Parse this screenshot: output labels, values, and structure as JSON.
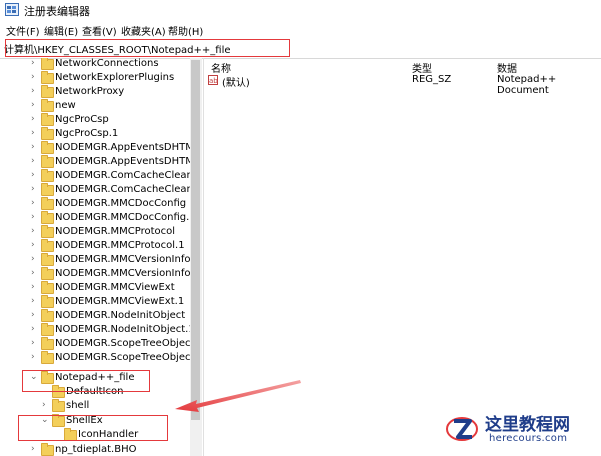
{
  "window": {
    "title": "注册表编辑器"
  },
  "menu": [
    {
      "label": "文件(F)"
    },
    {
      "label": "编辑(E)"
    },
    {
      "label": "查看(V)"
    },
    {
      "label": "收藏夹(A)"
    },
    {
      "label": "帮助(H)"
    }
  ],
  "address": "计算机\\HKEY_CLASSES_ROOT\\Notepad++_file",
  "tree": [
    {
      "label": "NetworkConnections"
    },
    {
      "label": "NetworkExplorerPlugins"
    },
    {
      "label": "NetworkProxy"
    },
    {
      "label": "new"
    },
    {
      "label": "NgcProCsp"
    },
    {
      "label": "NgcProCsp.1"
    },
    {
      "label": "NODEMGR.AppEventsDHTMLCo"
    },
    {
      "label": "NODEMGR.AppEventsDHTMLCo"
    },
    {
      "label": "NODEMGR.ComCacheCleanup"
    },
    {
      "label": "NODEMGR.ComCacheCleanup.1"
    },
    {
      "label": "NODEMGR.MMCDocConfig"
    },
    {
      "label": "NODEMGR.MMCDocConfig.1"
    },
    {
      "label": "NODEMGR.MMCProtocol"
    },
    {
      "label": "NODEMGR.MMCProtocol.1"
    },
    {
      "label": "NODEMGR.MMCVersionInfo"
    },
    {
      "label": "NODEMGR.MMCVersionInfo.1"
    },
    {
      "label": "NODEMGR.MMCViewExt"
    },
    {
      "label": "NODEMGR.MMCViewExt.1"
    },
    {
      "label": "NODEMGR.NodeInitObject"
    },
    {
      "label": "NODEMGR.NodeInitObject.1"
    },
    {
      "label": "NODEMGR.ScopeTreeObject"
    },
    {
      "label": "NODEMGR.ScopeTreeObject.1"
    },
    {
      "label": "Notepad++_file"
    },
    {
      "label": "DefaultIcon"
    },
    {
      "label": "shell"
    },
    {
      "label": "ShellEx"
    },
    {
      "label": "IconHandler"
    },
    {
      "label": "np_tdieplat.BHO"
    }
  ],
  "list": {
    "headers": {
      "name": "名称",
      "type": "类型",
      "data": "数据"
    },
    "rows": [
      {
        "name": "(默认)",
        "type": "REG_SZ",
        "data": "Notepad++ Document",
        "icon": "ab-icon"
      }
    ]
  },
  "watermark": {
    "name": "这里教程网",
    "url": "herecours.com"
  },
  "colors": {
    "highlight": "#e4393c",
    "folder": "#f3cf5a",
    "brand": "#1f3d8a"
  }
}
